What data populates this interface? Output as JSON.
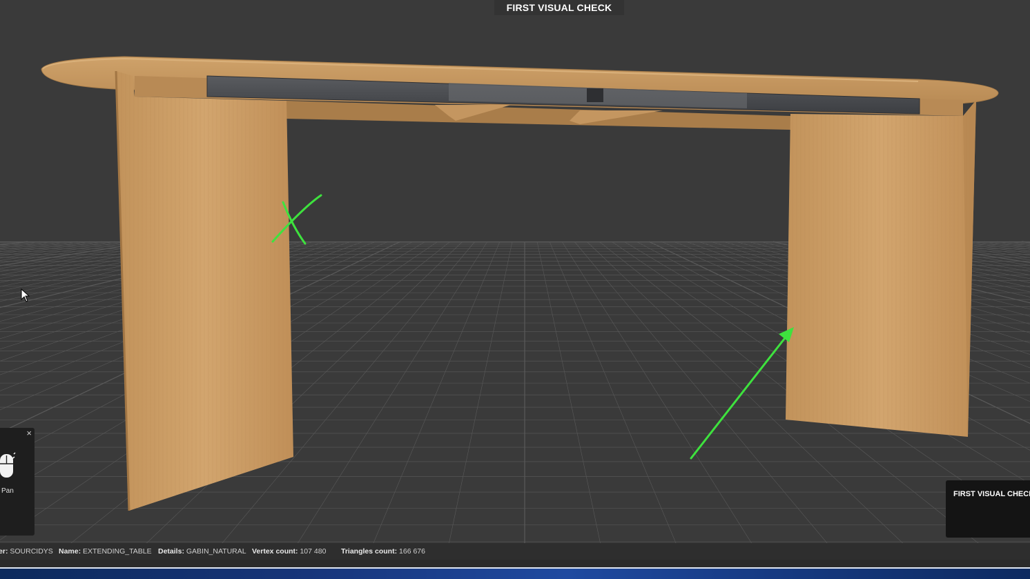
{
  "viewer": {
    "title": "FIRST VISUAL CHECK"
  },
  "controls_panel": {
    "close_glyph": "×",
    "mouse_icon": "mouse-drag-icon",
    "action_label": "Pan"
  },
  "notes_panel": {
    "title": "FIRST VISUAL CHECK"
  },
  "info_bar": {
    "fields": [
      {
        "key": "er",
        "value": "SOURCIDYS"
      },
      {
        "key": "Name",
        "value": "EXTENDING_TABLE"
      },
      {
        "key": "Details",
        "value": "GABIN_NATURAL"
      },
      {
        "key": "Vertex count",
        "value": "107 480"
      },
      {
        "key": "Triangles count",
        "value": "166 676"
      }
    ]
  },
  "annotations": {
    "color": "#3ee23e",
    "marks": [
      "x-mark-icon",
      "arrow-icon"
    ]
  },
  "scene": {
    "background_color": "#3a3a3a",
    "grid_color": "#5a5a5a",
    "wood_color": "#c99a62",
    "metal_color": "#4a4c50"
  }
}
